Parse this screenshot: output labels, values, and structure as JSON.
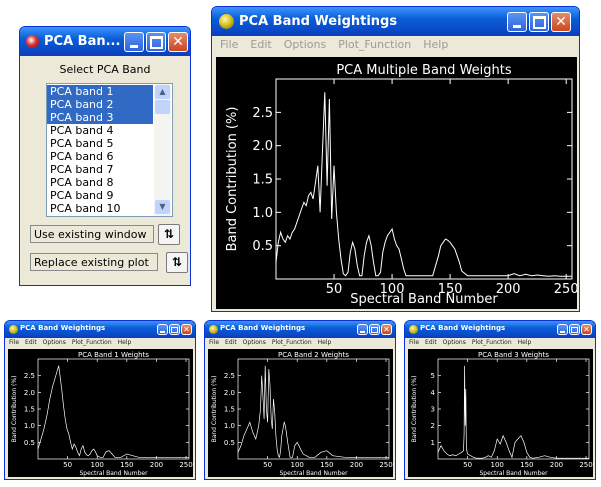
{
  "selector_window": {
    "title": "PCA Ban...",
    "prompt": "Select PCA Band",
    "bands": [
      "PCA band 1",
      "PCA band 2",
      "PCA band 3",
      "PCA band 4",
      "PCA band 5",
      "PCA band 6",
      "PCA band 7",
      "PCA band 8",
      "PCA band 9",
      "PCA band 10"
    ],
    "selected": [
      0,
      1,
      2
    ],
    "window_mode": "Use existing window",
    "plot_mode": "Replace existing plot"
  },
  "main_window": {
    "title": "PCA Band Weightings",
    "menu": [
      "File",
      "Edit",
      "Options",
      "Plot_Function",
      "Help"
    ]
  },
  "small_windows": [
    {
      "title": "PCA Band Weightings",
      "menu": [
        "File",
        "Edit",
        "Options",
        "Plot_Function",
        "Help"
      ]
    },
    {
      "title": "PCA Band Weightings",
      "menu": [
        "File",
        "Edit",
        "Options",
        "Plot_Function",
        "Help"
      ]
    },
    {
      "title": "PCA Band Weightings",
      "menu": [
        "File",
        "Edit",
        "Options",
        "Plot_Function",
        "Help"
      ]
    }
  ],
  "chart_data": [
    {
      "type": "line",
      "title": "PCA Multiple Band Weights",
      "xlabel": "Spectral Band Number",
      "ylabel": "Band Contribution (%)",
      "xlim": [
        0,
        255
      ],
      "ylim": [
        0,
        3.0
      ],
      "xticks": [
        50,
        100,
        150,
        200,
        250
      ],
      "yticks": [
        0.5,
        1.0,
        1.5,
        2.0,
        2.5
      ],
      "ytick_labels": [
        "0.5",
        "1.0",
        "1.5",
        "2.0",
        "2.5"
      ],
      "x": [
        0,
        2,
        4,
        6,
        8,
        10,
        12,
        14,
        16,
        18,
        20,
        22,
        24,
        26,
        28,
        30,
        32,
        34,
        36,
        38,
        40,
        42,
        44,
        46,
        48,
        50,
        52,
        54,
        56,
        58,
        60,
        62,
        64,
        66,
        68,
        70,
        72,
        74,
        76,
        78,
        80,
        82,
        84,
        86,
        88,
        90,
        92,
        94,
        96,
        98,
        100,
        102,
        104,
        106,
        108,
        110,
        112,
        114,
        116,
        118,
        120,
        125,
        130,
        135,
        140,
        142,
        144,
        146,
        148,
        150,
        152,
        154,
        156,
        158,
        160,
        165,
        170,
        180,
        190,
        200,
        205,
        210,
        215,
        220,
        225,
        230,
        235,
        240,
        245,
        250,
        255
      ],
      "y": [
        0.25,
        0.55,
        0.7,
        0.6,
        0.55,
        0.65,
        0.6,
        0.7,
        0.75,
        0.85,
        0.95,
        1.05,
        1.15,
        1.1,
        1.25,
        1.3,
        1.2,
        1.45,
        1.7,
        1.0,
        1.9,
        2.8,
        1.4,
        2.7,
        0.9,
        1.7,
        1.0,
        0.6,
        0.3,
        0.08,
        0.05,
        0.1,
        0.4,
        0.55,
        0.45,
        0.2,
        0.05,
        0.05,
        0.35,
        0.55,
        0.65,
        0.5,
        0.25,
        0.05,
        0.05,
        0.1,
        0.4,
        0.55,
        0.65,
        0.7,
        0.75,
        0.6,
        0.5,
        0.45,
        0.3,
        0.15,
        0.05,
        0.05,
        0.05,
        0.05,
        0.05,
        0.05,
        0.05,
        0.05,
        0.35,
        0.5,
        0.55,
        0.6,
        0.58,
        0.55,
        0.5,
        0.45,
        0.35,
        0.25,
        0.12,
        0.05,
        0.05,
        0.05,
        0.05,
        0.05,
        0.08,
        0.05,
        0.07,
        0.05,
        0.06,
        0.05,
        0.04,
        0.05,
        0.04,
        0.04,
        0.04
      ]
    },
    {
      "type": "line",
      "title": "PCA Band 1 Weights",
      "xlabel": "Spectral Band Number",
      "ylabel": "Band Contribution (%)",
      "xlim": [
        0,
        255
      ],
      "ylim": [
        0,
        3.0
      ],
      "xticks": [
        50,
        100,
        150,
        200,
        250
      ],
      "yticks": [
        0.5,
        1.0,
        1.5,
        2.0,
        2.5
      ],
      "ytick_labels": [
        "0.5",
        "1.0",
        "1.5",
        "2.0",
        "2.5"
      ],
      "x": [
        0,
        5,
        10,
        15,
        20,
        25,
        30,
        35,
        40,
        43,
        46,
        49,
        52,
        55,
        58,
        61,
        64,
        67,
        70,
        73,
        76,
        79,
        82,
        85,
        88,
        91,
        94,
        97,
        100,
        105,
        110,
        115,
        120,
        125,
        130,
        140,
        150,
        160,
        170,
        180,
        200,
        220,
        240,
        255
      ],
      "y": [
        0.3,
        0.6,
        0.9,
        1.3,
        1.8,
        2.2,
        2.5,
        2.8,
        2.1,
        1.6,
        1.2,
        0.9,
        0.75,
        0.5,
        0.3,
        0.45,
        0.35,
        0.2,
        0.1,
        0.3,
        0.4,
        0.2,
        0.12,
        0.1,
        0.15,
        0.25,
        0.3,
        0.22,
        0.1,
        0.05,
        0.05,
        0.22,
        0.25,
        0.15,
        0.05,
        0.05,
        0.15,
        0.1,
        0.05,
        0.05,
        0.04,
        0.04,
        0.04,
        0.04
      ]
    },
    {
      "type": "line",
      "title": "PCA Band 2 Weights",
      "xlabel": "Spectral Band Number",
      "ylabel": "Band Contribution (%)",
      "xlim": [
        0,
        255
      ],
      "ylim": [
        0,
        3.0
      ],
      "xticks": [
        50,
        100,
        150,
        200,
        250
      ],
      "yticks": [
        0.5,
        1.0,
        1.5,
        2.0,
        2.5
      ],
      "ytick_labels": [
        "0.5",
        "1.0",
        "1.5",
        "2.0",
        "2.5"
      ],
      "x": [
        0,
        5,
        10,
        15,
        20,
        25,
        30,
        35,
        38,
        40,
        42,
        44,
        46,
        48,
        50,
        52,
        54,
        56,
        58,
        60,
        62,
        64,
        66,
        68,
        70,
        72,
        74,
        76,
        78,
        80,
        84,
        88,
        92,
        96,
        100,
        110,
        120,
        130,
        140,
        150,
        160,
        180,
        200,
        220,
        240,
        255
      ],
      "y": [
        0.2,
        0.4,
        0.7,
        0.9,
        1.1,
        0.8,
        0.6,
        1.0,
        1.5,
        2.5,
        1.9,
        1.2,
        2.8,
        1.5,
        1.1,
        2.7,
        2.2,
        1.2,
        0.9,
        1.8,
        1.4,
        0.7,
        0.3,
        0.1,
        0.05,
        0.25,
        0.7,
        0.9,
        1.1,
        1.0,
        0.5,
        0.05,
        0.05,
        0.4,
        0.5,
        0.15,
        0.05,
        0.05,
        0.2,
        0.25,
        0.1,
        0.05,
        0.04,
        0.04,
        0.04,
        0.04
      ]
    },
    {
      "type": "line",
      "title": "PCA Band 3 Weights",
      "xlabel": "Spectral Band Number",
      "ylabel": "Band Contribution (%)",
      "xlim": [
        0,
        255
      ],
      "ylim": [
        0,
        6.0
      ],
      "xticks": [
        50,
        100,
        150,
        200,
        250
      ],
      "yticks": [
        1,
        2,
        3,
        4,
        5
      ],
      "ytick_labels": [
        "1",
        "2",
        "3",
        "4",
        "5"
      ],
      "x": [
        0,
        5,
        10,
        15,
        20,
        25,
        30,
        35,
        40,
        43,
        44,
        45,
        46,
        47,
        48,
        50,
        55,
        60,
        65,
        70,
        75,
        80,
        85,
        90,
        95,
        100,
        105,
        110,
        115,
        120,
        125,
        130,
        135,
        140,
        145,
        150,
        155,
        160,
        170,
        180,
        190,
        200,
        220,
        240,
        255
      ],
      "y": [
        0.4,
        0.8,
        0.5,
        0.3,
        0.2,
        0.25,
        0.2,
        0.3,
        0.4,
        0.5,
        1.5,
        5.6,
        2.0,
        4.2,
        0.6,
        0.3,
        0.2,
        0.1,
        0.05,
        0.05,
        0.05,
        0.1,
        0.2,
        0.1,
        0.5,
        1.2,
        0.9,
        1.4,
        1.0,
        0.5,
        0.1,
        1.0,
        1.2,
        1.4,
        1.0,
        0.4,
        0.1,
        0.05,
        0.1,
        0.2,
        0.1,
        0.05,
        0.05,
        0.05,
        0.05
      ]
    }
  ]
}
